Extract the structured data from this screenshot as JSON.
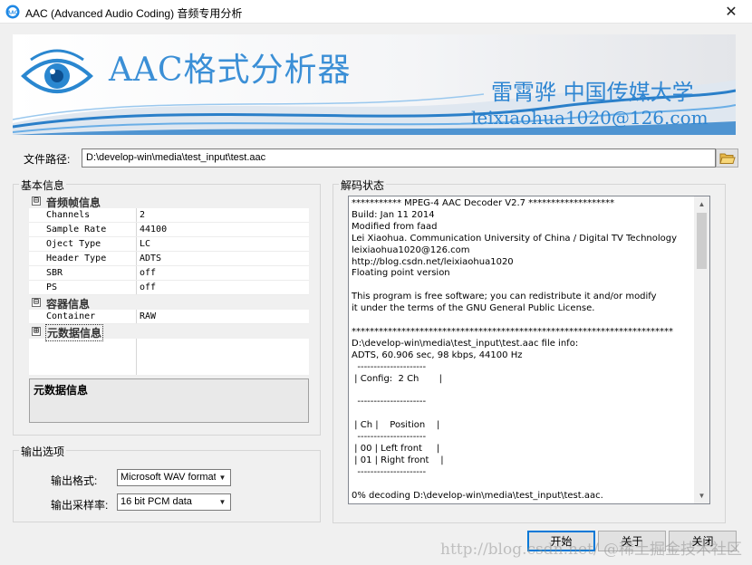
{
  "window": {
    "title": "AAC (Advanced Audio Coding) 音频专用分析",
    "close_glyph": "✕"
  },
  "banner": {
    "title": "AAC格式分析器",
    "author": "雷霄骅  中国传媒大学",
    "email": "leixiaohua1020@126.com"
  },
  "file_path": {
    "label": "文件路径:",
    "value": "D:\\develop-win\\media\\test_input\\test.aac"
  },
  "basic_info": {
    "legend": "基本信息",
    "categories": {
      "frame": {
        "toggle": "⊟",
        "label": "音频帧信息"
      },
      "container": {
        "toggle": "⊟",
        "label": "容器信息"
      },
      "metadata": {
        "toggle": "⊞",
        "label": "元数据信息"
      }
    },
    "rows": [
      {
        "key": "Channels",
        "value": "2"
      },
      {
        "key": "Sample Rate",
        "value": "44100"
      },
      {
        "key": "Oject Type",
        "value": "LC"
      },
      {
        "key": "Header Type",
        "value": "ADTS"
      },
      {
        "key": "SBR",
        "value": "off"
      },
      {
        "key": "PS",
        "value": "off"
      },
      {
        "key": "Container",
        "value": "RAW"
      }
    ],
    "description_title": "元数据信息"
  },
  "output": {
    "legend": "输出选项",
    "format_label": "输出格式:",
    "format_value": "Microsoft WAV format",
    "rate_label": "输出采样率:",
    "rate_value": "16 bit PCM data"
  },
  "decode": {
    "legend": "解码状态",
    "log": "*********** MPEG-4 AAC Decoder V2.7 *******************\nBuild: Jan 11 2014\nModified from faad\nLei Xiaohua. Communication University of China / Digital TV Technology\nleixiaohua1020@126.com\nhttp://blog.csdn.net/leixiaohua1020\nFloating point version\n\nThis program is free software; you can redistribute it and/or modify\nit under the terms of the GNU General Public License.\n\n***********************************************************************\nD:\\develop-win\\media\\test_input\\test.aac file info:\nADTS, 60.906 sec, 98 kbps, 44100 Hz\n  ---------------------\n | Config:  2 Ch       |\n\n  ---------------------\n\n | Ch |    Position    |\n  ---------------------\n | 00 | Left front     |\n | 01 | Right front    |\n  ---------------------\n\n0% decoding D:\\develop-win\\media\\test_input\\test.aac."
  },
  "buttons": {
    "start": "开始",
    "about": "关于",
    "close": "关闭"
  },
  "watermark": "http://blog.csdn.net/ @稀土掘金技术社区"
}
